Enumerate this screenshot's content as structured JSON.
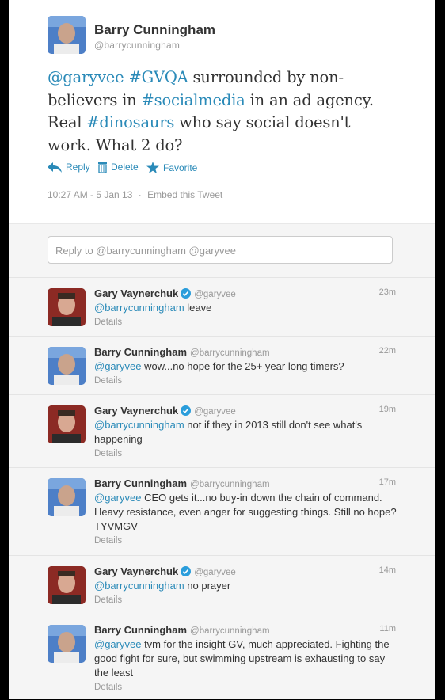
{
  "main_tweet": {
    "name": "Barry Cunningham",
    "handle": "@barrycunningham",
    "text_parts": [
      {
        "t": "@garyvee",
        "link": true
      },
      {
        "t": " ",
        "link": false
      },
      {
        "t": "#GVQA",
        "link": true
      },
      {
        "t": " surrounded by non-believers in ",
        "link": false
      },
      {
        "t": "#socialmedia",
        "link": true
      },
      {
        "t": " in an ad agency. Real ",
        "link": false
      },
      {
        "t": "#dinosaurs",
        "link": true
      },
      {
        "t": " who say social doesn't work. What 2 do?",
        "link": false
      }
    ],
    "actions": {
      "reply": "Reply",
      "delete": "Delete",
      "favorite": "Favorite"
    },
    "timestamp": "10:27 AM - 5 Jan 13",
    "separator": "·",
    "embed": "Embed this Tweet"
  },
  "reply_box": {
    "placeholder": "Reply to @barrycunningham @garyvee"
  },
  "colors": {
    "link": "#2a8ab8",
    "verified": "#2a9ddb"
  },
  "replies": [
    {
      "name": "Gary Vaynerchuk",
      "verified": true,
      "handle": "@garyvee",
      "time": "23m",
      "mention": "@barrycunningham",
      "text": " leave",
      "details": "Details",
      "avatar": "gary"
    },
    {
      "name": "Barry Cunningham",
      "verified": false,
      "handle": "@barrycunningham",
      "time": "22m",
      "mention": "@garyvee",
      "text": " wow...no hope for the 25+ year long timers?",
      "details": "Details",
      "avatar": "barry"
    },
    {
      "name": "Gary Vaynerchuk",
      "verified": true,
      "handle": "@garyvee",
      "time": "19m",
      "mention": "@barrycunningham",
      "text": " not if they in 2013 still don't see what's happening",
      "details": "Details",
      "avatar": "gary"
    },
    {
      "name": "Barry Cunningham",
      "verified": false,
      "handle": "@barrycunningham",
      "time": "17m",
      "mention": "@garyvee",
      "text": " CEO gets it...no buy-in down the chain of command. Heavy resistance, even anger for suggesting things. Still no hope? TYVMGV",
      "details": "Details",
      "avatar": "barry"
    },
    {
      "name": "Gary Vaynerchuk",
      "verified": true,
      "handle": "@garyvee",
      "time": "14m",
      "mention": "@barrycunningham",
      "text": " no prayer",
      "details": "Details",
      "avatar": "gary"
    },
    {
      "name": "Barry Cunningham",
      "verified": false,
      "handle": "@barrycunningham",
      "time": "11m",
      "mention": "@garyvee",
      "text": " tvm for the insight GV, much appreciated. Fighting the good fight for sure, but swimming upstream is exhausting to say the least",
      "details": "Details",
      "avatar": "barry"
    }
  ]
}
